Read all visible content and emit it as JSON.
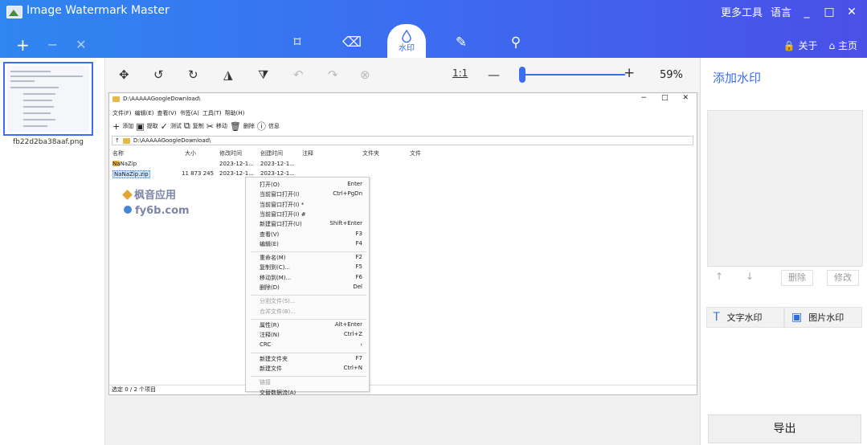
{
  "app": {
    "title": "Image Watermark Master"
  },
  "top_right": {
    "more_tools": "更多工具",
    "language": "语言",
    "minimize": "_",
    "maximize": "□",
    "close": "✕"
  },
  "left_tools": {
    "add": "+",
    "remove": "−",
    "clear": "✕"
  },
  "tabs": [
    {
      "icon": "crop-icon",
      "glyph": "⌑"
    },
    {
      "icon": "eraser-icon",
      "glyph": "⌫"
    },
    {
      "icon": "watermark-drop-icon",
      "glyph": "💧",
      "label": "水印",
      "active": true
    },
    {
      "icon": "brush-icon",
      "glyph": "✎"
    },
    {
      "icon": "pin-icon",
      "glyph": "⚲"
    }
  ],
  "nav_right": {
    "about": "关于",
    "home": "主页"
  },
  "thumbnail": {
    "filename": "fb22d2ba38aaf.png"
  },
  "toolbar": {
    "ratio_label": "1:1",
    "zoom_minus": "—",
    "zoom_plus": "+",
    "zoom_percent": "59%",
    "zoom_level": 0.59
  },
  "screenshot": {
    "path": "D:\\AAAAAGoogleDownload\\",
    "window_controls": [
      "−",
      "□",
      "✕"
    ],
    "menu": [
      "文件(F)",
      "编辑(E)",
      "查看(V)",
      "书签(A)",
      "工具(T)",
      "帮助(H)"
    ],
    "toolbar": [
      {
        "glyph": "+",
        "label": "添加"
      },
      {
        "glyph": "▣",
        "label": "提取"
      },
      {
        "glyph": "✓",
        "label": "测试"
      },
      {
        "glyph": "⧉",
        "label": "复制"
      },
      {
        "glyph": "✂",
        "label": "移动"
      },
      {
        "glyph": "🗑",
        "label": "删除"
      },
      {
        "glyph": "ⓘ",
        "label": "信息"
      }
    ],
    "address": "D:\\AAAAAGoogleDownload\\",
    "columns": [
      "名称",
      "大小",
      "修改时间",
      "创建时间",
      "注释",
      "文件夹",
      "文件"
    ],
    "rows": [
      {
        "name": "NaNaZip",
        "size": "",
        "modified": "2023-12-1...",
        "created": "2023-12-1..."
      },
      {
        "name": "NaNaZip.zip",
        "size": "11 873 245",
        "modified": "2023-12-1...",
        "created": "2023-12-1..."
      }
    ],
    "watermark_line1": "枫音应用",
    "watermark_line2": "fy6b.com",
    "status": "选定 0 / 2 个项目",
    "context_menu": [
      {
        "label": "打开(O)",
        "key": "Enter"
      },
      {
        "label": "当前窗口打开(I)",
        "key": "Ctrl+PgDn"
      },
      {
        "label": "当前窗口打开(I) *",
        "key": ""
      },
      {
        "label": "当前窗口打开(I) #",
        "key": ""
      },
      {
        "label": "新建窗口打开(U)",
        "key": "Shift+Enter"
      },
      {
        "label": "查看(V)",
        "key": "F3"
      },
      {
        "label": "编辑(E)",
        "key": "F4"
      },
      {
        "sep": true
      },
      {
        "label": "重命名(M)",
        "key": "F2"
      },
      {
        "label": "复制到(C)...",
        "key": "F5"
      },
      {
        "label": "移动到(M)...",
        "key": "F6"
      },
      {
        "label": "删除(D)",
        "key": "Del"
      },
      {
        "sep": true
      },
      {
        "label": "分割文件(S)...",
        "key": "",
        "disabled": true
      },
      {
        "label": "合并文件(B)...",
        "key": "",
        "disabled": true
      },
      {
        "sep": true
      },
      {
        "label": "属性(R)",
        "key": "Alt+Enter"
      },
      {
        "label": "注释(N)",
        "key": "Ctrl+Z"
      },
      {
        "label": "CRC",
        "key": "›"
      },
      {
        "sep": true
      },
      {
        "label": "新建文件夹",
        "key": "F7"
      },
      {
        "label": "新建文件",
        "key": "Ctrl+N"
      },
      {
        "sep": true
      },
      {
        "label": "链接",
        "key": "",
        "disabled": true
      },
      {
        "label": "交替数据流(A)",
        "key": ""
      }
    ]
  },
  "right_panel": {
    "title": "添加水印",
    "up": "↑",
    "down": "↓",
    "delete": "删除",
    "modify": "修改",
    "text_watermark": "文字水印",
    "image_watermark": "图片水印",
    "export": "导出"
  }
}
